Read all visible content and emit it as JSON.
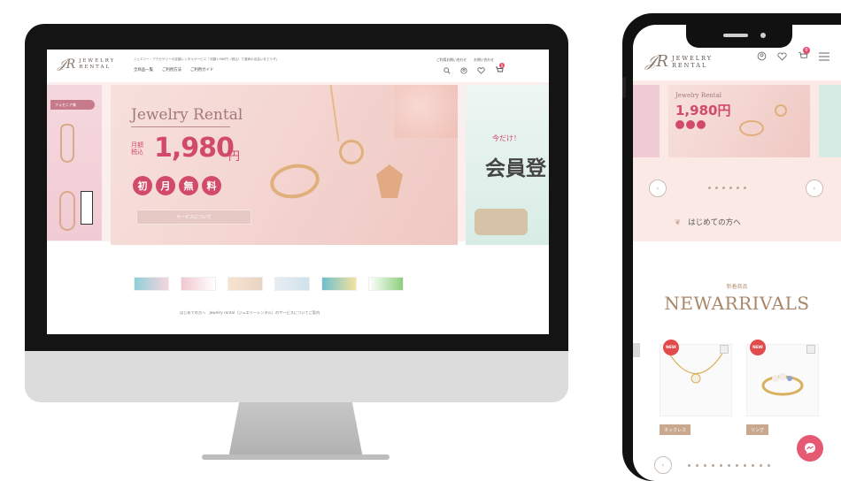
{
  "desktop": {
    "logo": {
      "mark": "𝒥𝑅",
      "line1": "JEWELRY",
      "line2": "RENTAL"
    },
    "tagline": "ジュエリー・アクセサリーの定額レンタルサービス「月額1,980円（税込）で運命の出会いをどうぞ」",
    "nav": [
      "全商品一覧",
      "ご利用方法",
      "ご利用ガイド"
    ],
    "links": [
      "ご利用お問い合わせ",
      "お問い合わせ"
    ],
    "cart_count": "0",
    "hero": {
      "side_tag": "フォセニア集",
      "title": "Jewelry Rental",
      "price_label_line1": "月額",
      "price_label_line2": "税込",
      "price": "1,980",
      "yen": "円",
      "circles": [
        "初",
        "月",
        "無",
        "料"
      ],
      "button": "サービスについて",
      "right_small": "今だけ！",
      "right_big": "会員登"
    },
    "info": "はじめての方へ　Jewelry rental（ジュエリーレンタル）のサービスについてご案内"
  },
  "mobile": {
    "logo": {
      "mark": "𝒥𝑅",
      "line1": "JEWELRY",
      "line2": "RENTAL"
    },
    "cart_count": "0",
    "hero": {
      "title": "Jewelry Rental",
      "price": "1,980円"
    },
    "first_time": "はじめての方へ",
    "new_sub": "新着商品",
    "new_title": "NEWARRIVALS",
    "badges": [
      "NEW",
      "NEW"
    ],
    "categories": [
      "ネックレス",
      "リング"
    ]
  },
  "colors": {
    "accent": "#d24a69",
    "brand": "#a88668",
    "bezel": "#141414"
  }
}
